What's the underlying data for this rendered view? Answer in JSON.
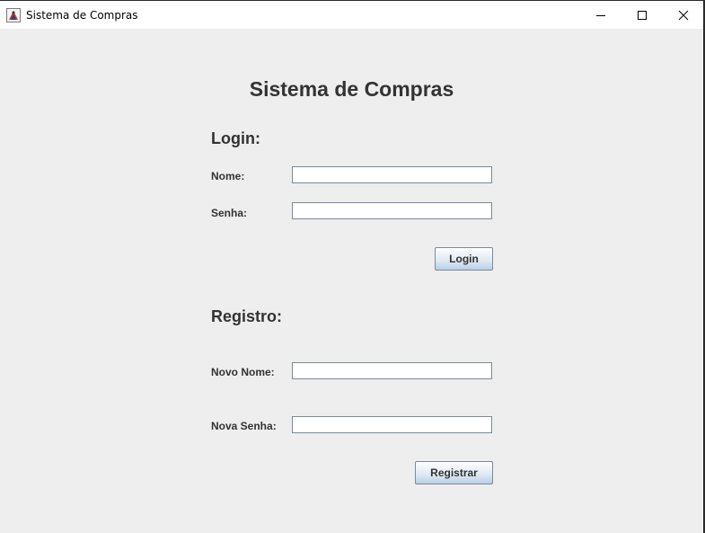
{
  "window": {
    "title": "Sistema de Compras",
    "controls": {
      "minimize": "minimize-icon",
      "maximize": "maximize-icon",
      "close": "close-icon"
    }
  },
  "page": {
    "heading": "Sistema de Compras"
  },
  "login": {
    "section_title": "Login:",
    "name_label": "Nome:",
    "name_value": "",
    "password_label": "Senha:",
    "password_value": "",
    "button_label": "Login"
  },
  "register": {
    "section_title": "Registro:",
    "new_name_label": "Novo Nome:",
    "new_name_value": "",
    "new_password_label": "Nova Senha:",
    "new_password_value": "",
    "button_label": "Registrar"
  },
  "colors": {
    "background": "#eeeeee",
    "text": "#333333",
    "field_border": "#7a8a99",
    "button_gradient_bottom": "#b8cfe5"
  }
}
